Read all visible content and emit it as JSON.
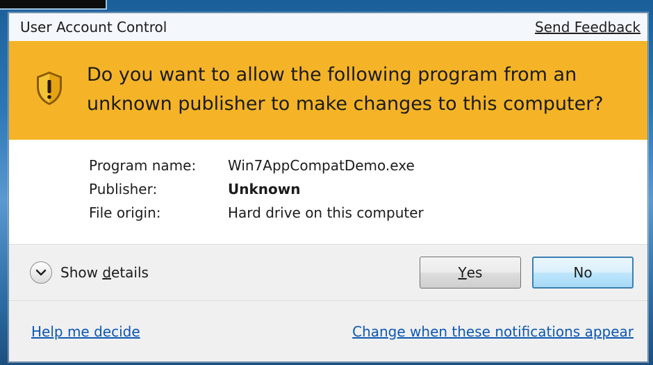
{
  "dialog": {
    "title": "User Account Control",
    "send_feedback": "Send Feedback",
    "question": "Do you want to allow the following program from an unknown publisher to make changes to this computer?",
    "details": [
      {
        "label": "Program name:",
        "value": "Win7AppCompatDemo.exe",
        "bold": false
      },
      {
        "label": "Publisher:",
        "value": "Unknown",
        "bold": true
      },
      {
        "label": "File origin:",
        "value": "Hard drive on this computer",
        "bold": false
      }
    ],
    "show_details": {
      "prefix": "Show ",
      "accel": "d",
      "suffix": "etails"
    },
    "yes": {
      "accel": "Y",
      "rest": "es"
    },
    "no": "No",
    "help": "Help me decide",
    "change_notifications": "Change when these notifications appear"
  },
  "colors": {
    "banner": "#f5b427",
    "link": "#0d57b3"
  },
  "icons": {
    "shield": "uac-shield-icon",
    "chevron": "chevron-down-icon"
  }
}
